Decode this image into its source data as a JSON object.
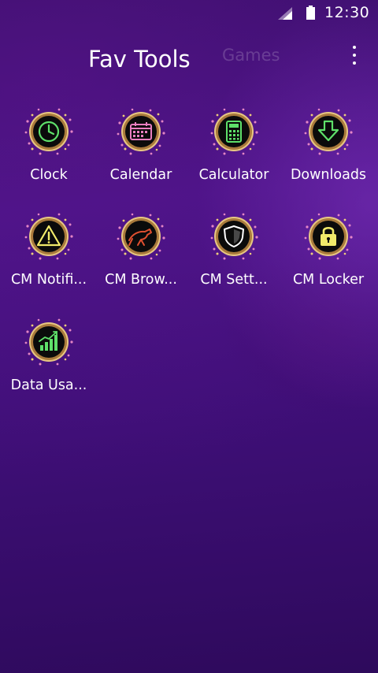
{
  "status_bar": {
    "time": "12:30",
    "icons": [
      "signal-icon",
      "battery-icon"
    ]
  },
  "header": {
    "tabs": [
      {
        "label": "Fav Tools",
        "active": true
      },
      {
        "label": "Games",
        "active": false
      }
    ],
    "menu_icon": "overflow-menu-icon"
  },
  "colors": {
    "background": "#3f0f78",
    "icon_ring": "#e8c27a",
    "icon_face": "#0a0a0a",
    "glyph_green": "#5ee06a",
    "glyph_pink": "#e87fbf",
    "glyph_yellow": "#f1ea6a",
    "glyph_red": "#e05030"
  },
  "apps": [
    {
      "label": "Clock",
      "icon": "clock-icon"
    },
    {
      "label": "Calendar",
      "icon": "calendar-icon"
    },
    {
      "label": "Calculator",
      "icon": "calculator-icon"
    },
    {
      "label": "Downloads",
      "icon": "download-arrow-icon"
    },
    {
      "label": "CM Notifi...",
      "icon": "warning-triangle-icon"
    },
    {
      "label": "CM Brow...",
      "icon": "cheetah-icon"
    },
    {
      "label": "CM Sett...",
      "icon": "shield-icon"
    },
    {
      "label": "CM Locker",
      "icon": "lock-icon"
    },
    {
      "label": "Data Usa...",
      "icon": "bar-chart-icon"
    }
  ]
}
